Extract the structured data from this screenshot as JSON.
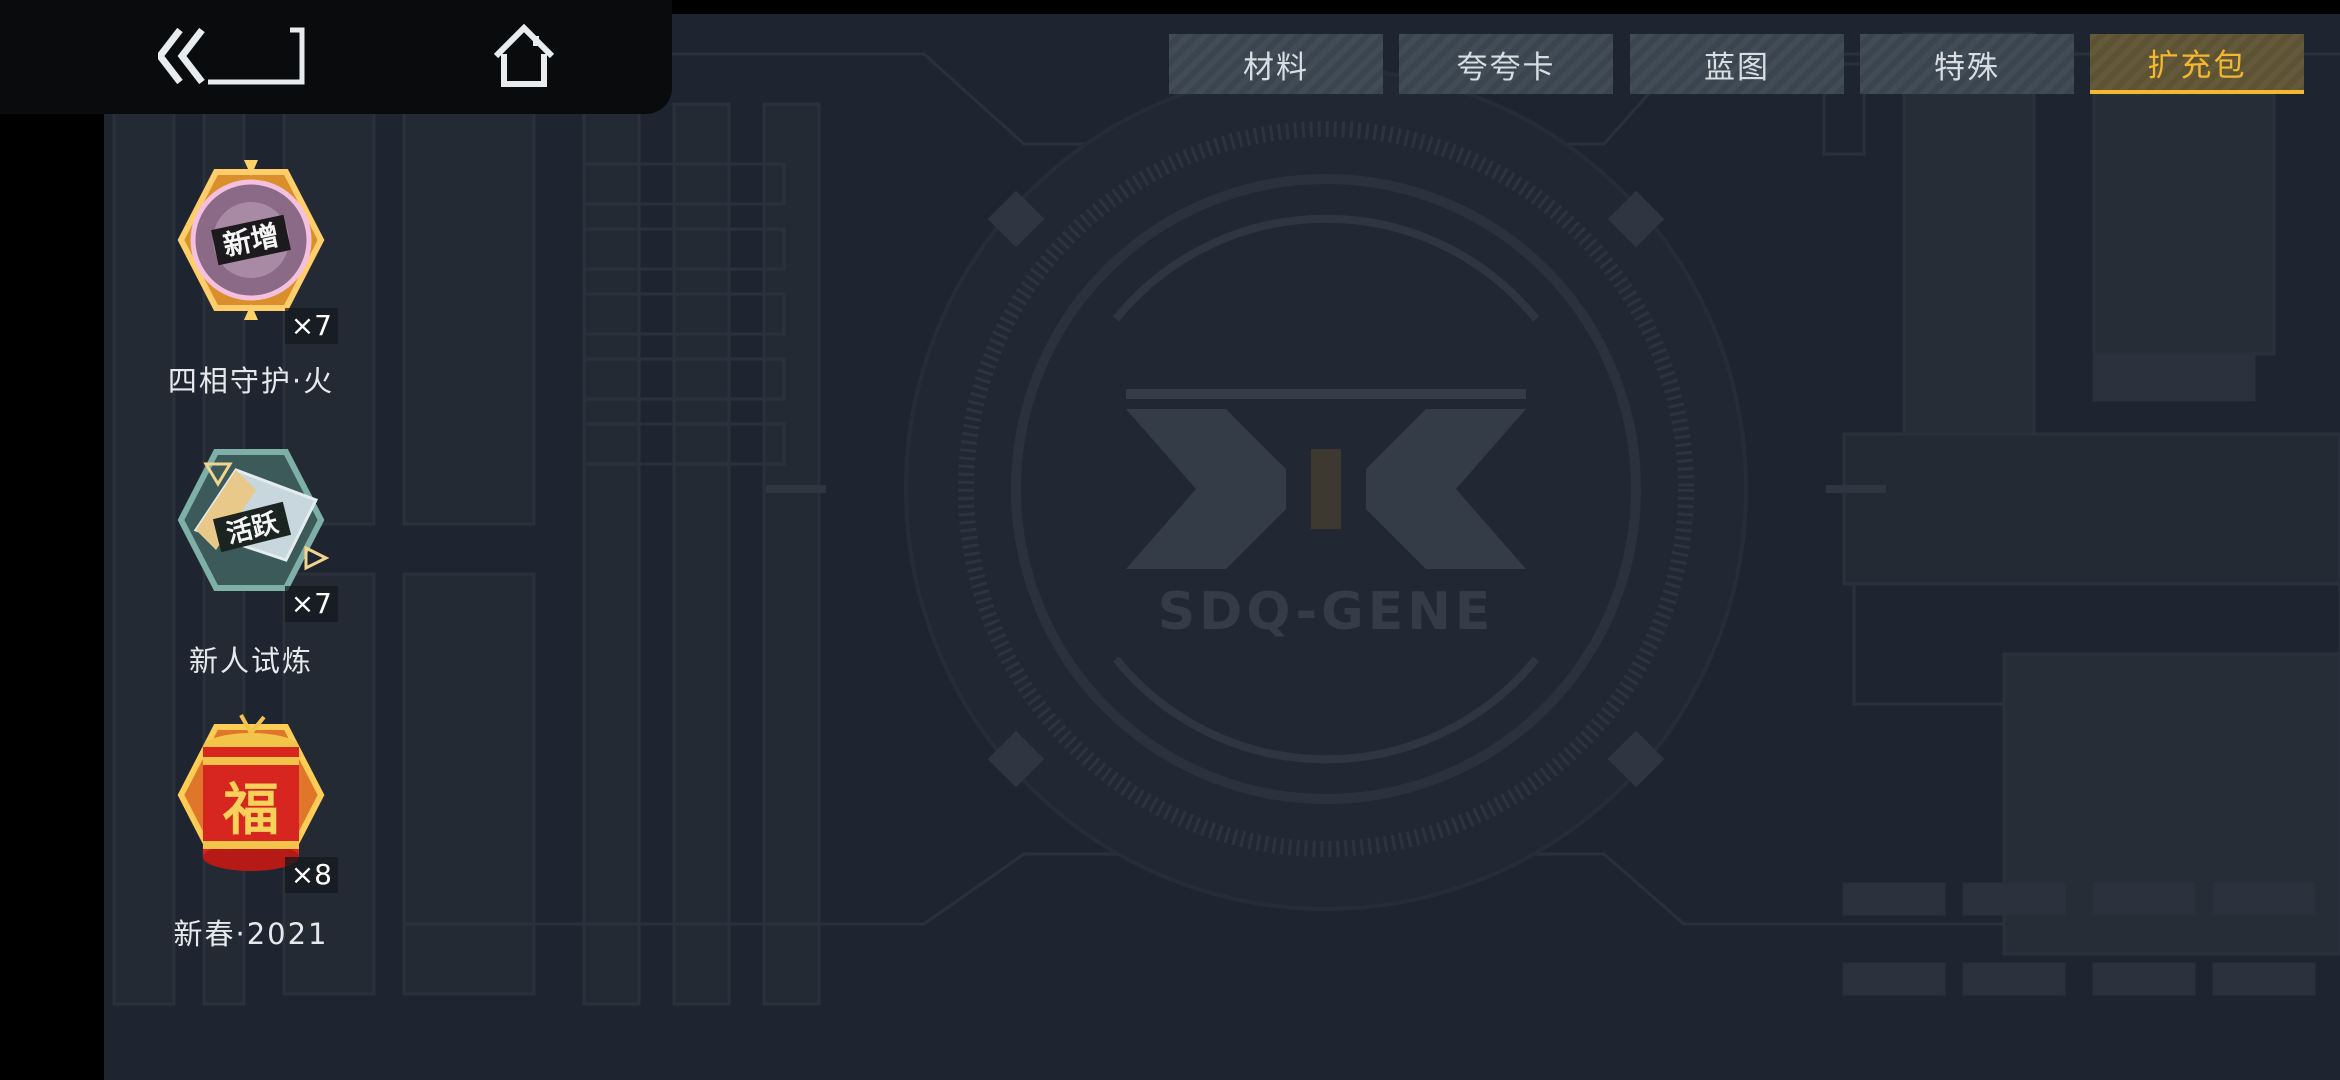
{
  "tabs": [
    {
      "label": "材料",
      "active": false
    },
    {
      "label": "夸夸卡",
      "active": false
    },
    {
      "label": "蓝图",
      "active": false
    },
    {
      "label": "特殊",
      "active": false
    },
    {
      "label": "扩充包",
      "active": true
    }
  ],
  "items": [
    {
      "name": "四相守护·火",
      "count": "×7",
      "badge_text": "新增",
      "icon": "card-pack-icon"
    },
    {
      "name": "新人试炼",
      "count": "×7",
      "badge_text": "活跃",
      "icon": "card-pack-icon"
    },
    {
      "name": "新春·2021",
      "count": "×8",
      "badge_text": "福",
      "icon": "firecracker-icon"
    }
  ],
  "logo_text": "SDQ-GENE",
  "colors": {
    "accent": "#f4b72f",
    "background": "#1f2530",
    "tab_bg": "#3a4550"
  }
}
